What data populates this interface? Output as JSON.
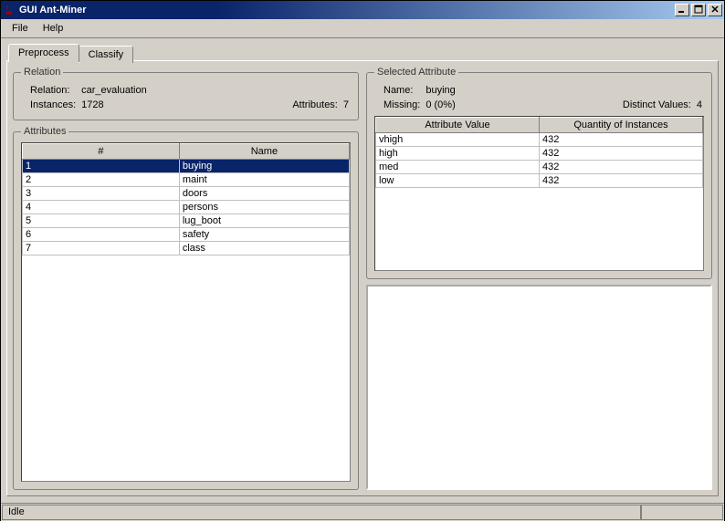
{
  "window": {
    "title": "GUI Ant-Miner"
  },
  "menu": {
    "file": "File",
    "help": "Help"
  },
  "tabs": {
    "preprocess": "Preprocess",
    "classify": "Classify"
  },
  "relation": {
    "legend": "Relation",
    "relation_label": "Relation:",
    "relation_value": "car_evaluation",
    "instances_label": "Instances:",
    "instances_value": "1728",
    "attributes_label": "Attributes:",
    "attributes_value": "7"
  },
  "attributes": {
    "legend": "Attributes",
    "col_num": "#",
    "col_name": "Name",
    "rows": [
      {
        "num": "1",
        "name": "buying",
        "selected": true
      },
      {
        "num": "2",
        "name": "maint",
        "selected": false
      },
      {
        "num": "3",
        "name": "doors",
        "selected": false
      },
      {
        "num": "4",
        "name": "persons",
        "selected": false
      },
      {
        "num": "5",
        "name": "lug_boot",
        "selected": false
      },
      {
        "num": "6",
        "name": "safety",
        "selected": false
      },
      {
        "num": "7",
        "name": "class",
        "selected": false
      }
    ]
  },
  "selected_attribute": {
    "legend": "Selected Attribute",
    "name_label": "Name:",
    "name_value": "buying",
    "missing_label": "Missing:",
    "missing_value": "0 (0%)",
    "distinct_label": "Distinct Values:",
    "distinct_value": "4",
    "col_value": "Attribute Value",
    "col_qty": "Quantity of Instances",
    "rows": [
      {
        "value": "vhigh",
        "qty": "432"
      },
      {
        "value": "high",
        "qty": "432"
      },
      {
        "value": "med",
        "qty": "432"
      },
      {
        "value": "low",
        "qty": "432"
      }
    ]
  },
  "status": {
    "text": "Idle"
  },
  "window_controls": {
    "minimize": "_",
    "maximize": "□",
    "close": "✕"
  }
}
